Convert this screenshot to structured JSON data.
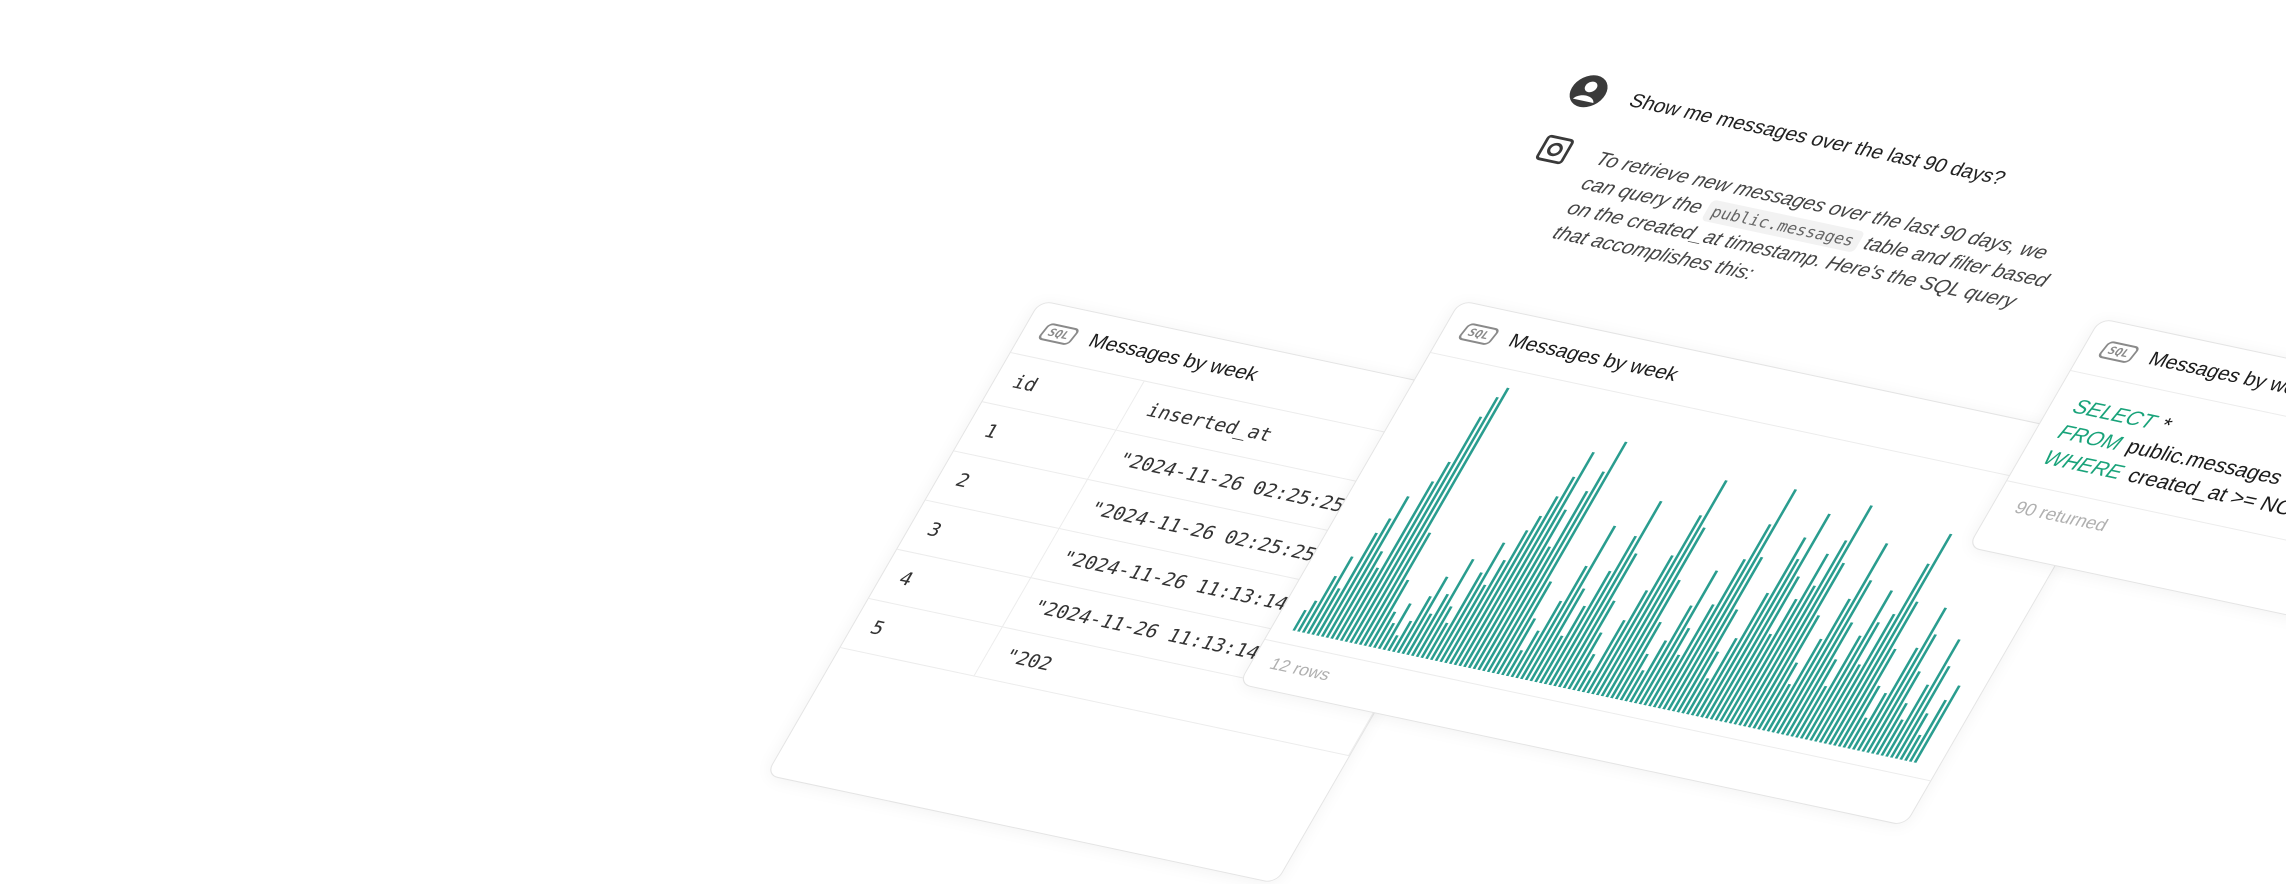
{
  "chat": {
    "user_message": "Show me messages over the last 90 days?",
    "ai_message_pre": "To retrieve new messages over the last 90 days, we can query the ",
    "ai_message_code": "public.messages",
    "ai_message_post": " table and filter based on the created_at timestamp. Here's the SQL query that accomplishes this:"
  },
  "table_card": {
    "title": "Messages by week",
    "badge": "SQL",
    "columns": [
      "id",
      "inserted_at"
    ],
    "rows": [
      [
        "1",
        "\"2024-11-26 02:25:25"
      ],
      [
        "2",
        "\"2024-11-26 02:25:25"
      ],
      [
        "3",
        "\"2024-11-26 11:13:14"
      ],
      [
        "4",
        "\"2024-11-26 11:13:14"
      ],
      [
        "5",
        "\"202"
      ]
    ]
  },
  "chart_card": {
    "title": "Messages by week",
    "badge": "SQL",
    "footer": "12 rows",
    "bar_color": "#2a9d8f"
  },
  "chart_data": {
    "type": "bar",
    "title": "Messages by week",
    "xlabel": "",
    "ylabel": "",
    "values": [
      8,
      12,
      22,
      30,
      18,
      40,
      46,
      55,
      34,
      28,
      62,
      70,
      88,
      96,
      100,
      44,
      26,
      14,
      10,
      18,
      6,
      12,
      22,
      30,
      16,
      24,
      38,
      20,
      14,
      34,
      46,
      30,
      40,
      52,
      58,
      66,
      74,
      84,
      62,
      48,
      70,
      78,
      90,
      36,
      22,
      10,
      18,
      30,
      44,
      60,
      36,
      18,
      30,
      44,
      58,
      72,
      52,
      34,
      22,
      14,
      8,
      28,
      40,
      54,
      70,
      84,
      66,
      46,
      30,
      18,
      12,
      24,
      38,
      52,
      30,
      20,
      40,
      58,
      72,
      86,
      60,
      40,
      24,
      14,
      30,
      48,
      70,
      62,
      80,
      56,
      34,
      48,
      66,
      54,
      72,
      86,
      64,
      44,
      26,
      18,
      36,
      52,
      74,
      60,
      44,
      30,
      20,
      40,
      58,
      46,
      30,
      50,
      70,
      82,
      56,
      38,
      24,
      12,
      22,
      40,
      56,
      46,
      32,
      20,
      14,
      28,
      46,
      36,
      18,
      10,
      24,
      30
    ],
    "ylim": [
      0,
      100
    ]
  },
  "sql_card": {
    "title": "Messages by week",
    "badge": "SQL",
    "lines": [
      {
        "kw": "SELECT",
        "text": "*"
      },
      {
        "kw": "FROM",
        "text": "public.messages"
      },
      {
        "kw": "WHERE",
        "text": "created_at >= NOW()"
      }
    ],
    "footer": "90 returned"
  },
  "colors": {
    "accent": "#19a37a",
    "bar": "#2a9d8f"
  }
}
